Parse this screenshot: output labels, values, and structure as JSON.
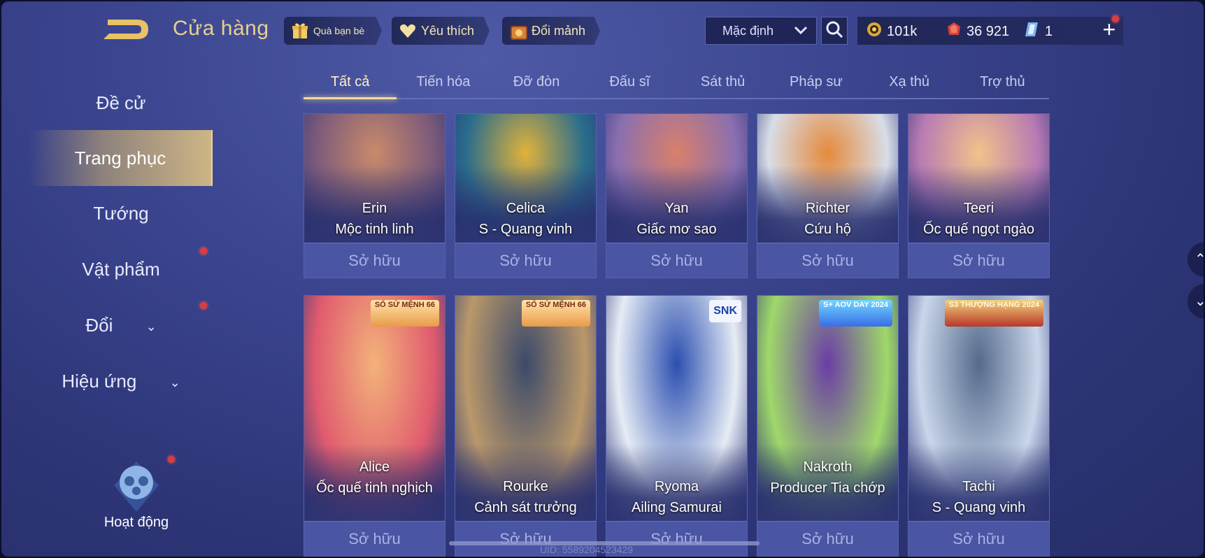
{
  "header": {
    "title": "Cửa hàng",
    "gift_label": "Quà bạn bè",
    "favorite_label": "Yêu thích",
    "exchange_label": "Đổi mảnh",
    "sort_value": "Mặc định",
    "currency": {
      "gold": "101k",
      "coupons": "36 921",
      "crystal": "1"
    }
  },
  "sidebar": {
    "items": [
      {
        "label": "Đề cử"
      },
      {
        "label": "Trang phục"
      },
      {
        "label": "Tướng"
      },
      {
        "label": "Vật phẩm"
      },
      {
        "label": "Đổi"
      },
      {
        "label": "Hiệu ứng"
      }
    ],
    "activity_label": "Hoạt động"
  },
  "tabs": [
    "Tất cả",
    "Tiến hóa",
    "Đỡ đòn",
    "Đấu sĩ",
    "Sát thủ",
    "Pháp sư",
    "Xạ thủ",
    "Trợ thủ"
  ],
  "cards": [
    {
      "hero": "Erin",
      "skin": "Mộc tinh linh",
      "status": "Sở hữu",
      "colors": [
        "#c98a6a",
        "#7b5a7a"
      ]
    },
    {
      "hero": "Celica",
      "skin": "S - Quang vinh",
      "status": "Sở hữu",
      "colors": [
        "#e2b23a",
        "#2a6d8c"
      ]
    },
    {
      "hero": "Yan",
      "skin": "Giấc mơ sao",
      "status": "Sở hữu",
      "colors": [
        "#d9806a",
        "#8a6fb0"
      ]
    },
    {
      "hero": "Richter",
      "skin": "Cứu hộ",
      "status": "Sở hữu",
      "colors": [
        "#e58a3c",
        "#d8dde8"
      ]
    },
    {
      "hero": "Teeri",
      "skin": "Ốc quế ngọt ngào",
      "status": "Sở hữu",
      "colors": [
        "#f1c38a",
        "#b77ab3"
      ]
    },
    {
      "hero": "Alice",
      "skin": "Ốc quế tinh nghịch",
      "status": "Sở hữu",
      "colors": [
        "#f3b27a",
        "#e05b6e"
      ],
      "badge": "SỔ SỨ MỆNH 66"
    },
    {
      "hero": "Rourke",
      "skin": "Cảnh sát trưởng",
      "status": "Sở hữu",
      "colors": [
        "#3c4a6a",
        "#b9986a"
      ],
      "badge": "SỔ SỨ MỆNH 66"
    },
    {
      "hero": "Ryoma",
      "skin": "Ailing Samurai",
      "status": "Sở hữu",
      "colors": [
        "#2b4fb0",
        "#e6ecf5"
      ],
      "badge": "SNK"
    },
    {
      "hero": "Nakroth",
      "skin": "Producer Tia chớp",
      "status": "Sở hữu",
      "colors": [
        "#6b3da6",
        "#9fd86a"
      ],
      "badge": "S+ AOV DAY 2024"
    },
    {
      "hero": "Tachi",
      "skin": "S - Quang vinh",
      "status": "Sở hữu",
      "colors": [
        "#556a8c",
        "#c9d6ea"
      ],
      "badge": "S3 THƯỢNG HẠNG 2024"
    }
  ],
  "footer": {
    "uid_text": "UID: 5589204523429"
  }
}
